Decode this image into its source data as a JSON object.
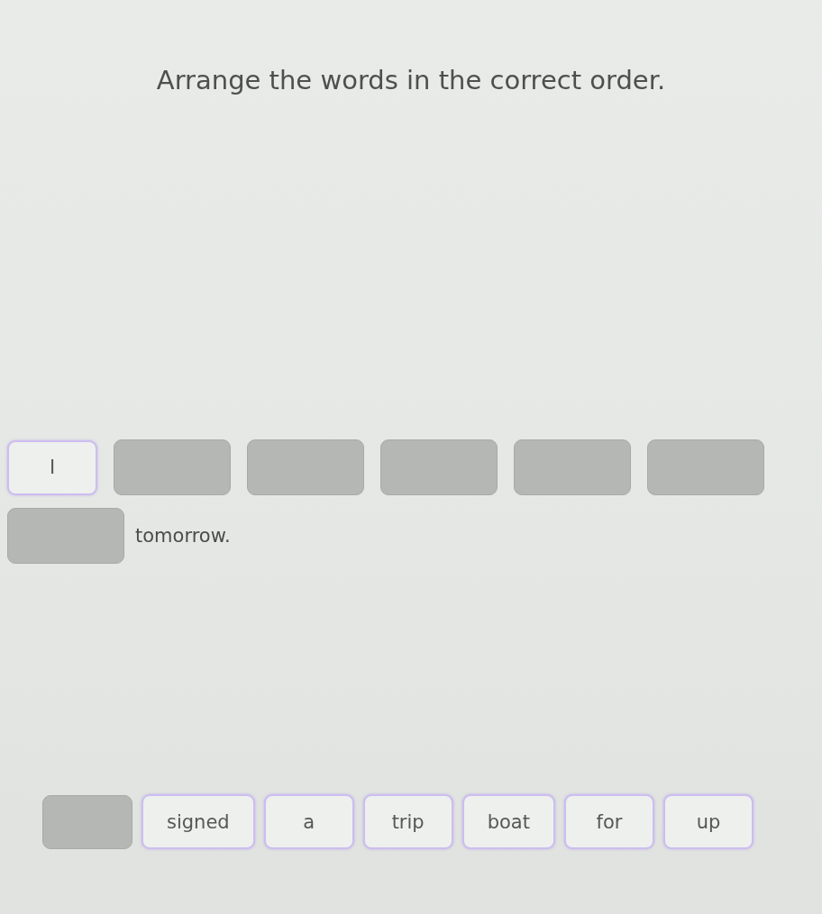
{
  "instruction": "Arrange the words in the correct order.",
  "answer": [
    {
      "kind": "tile",
      "text": "I"
    },
    {
      "kind": "slot"
    },
    {
      "kind": "slot"
    },
    {
      "kind": "slot"
    },
    {
      "kind": "slot"
    },
    {
      "kind": "slot"
    },
    {
      "kind": "slot"
    },
    {
      "kind": "text",
      "text": "tomorrow."
    }
  ],
  "word_bank": [
    {
      "kind": "used"
    },
    {
      "kind": "tile",
      "text": "signed"
    },
    {
      "kind": "tile",
      "text": "a"
    },
    {
      "kind": "tile",
      "text": "trip"
    },
    {
      "kind": "tile",
      "text": "boat"
    },
    {
      "kind": "tile",
      "text": "for"
    },
    {
      "kind": "tile",
      "text": "up"
    }
  ]
}
